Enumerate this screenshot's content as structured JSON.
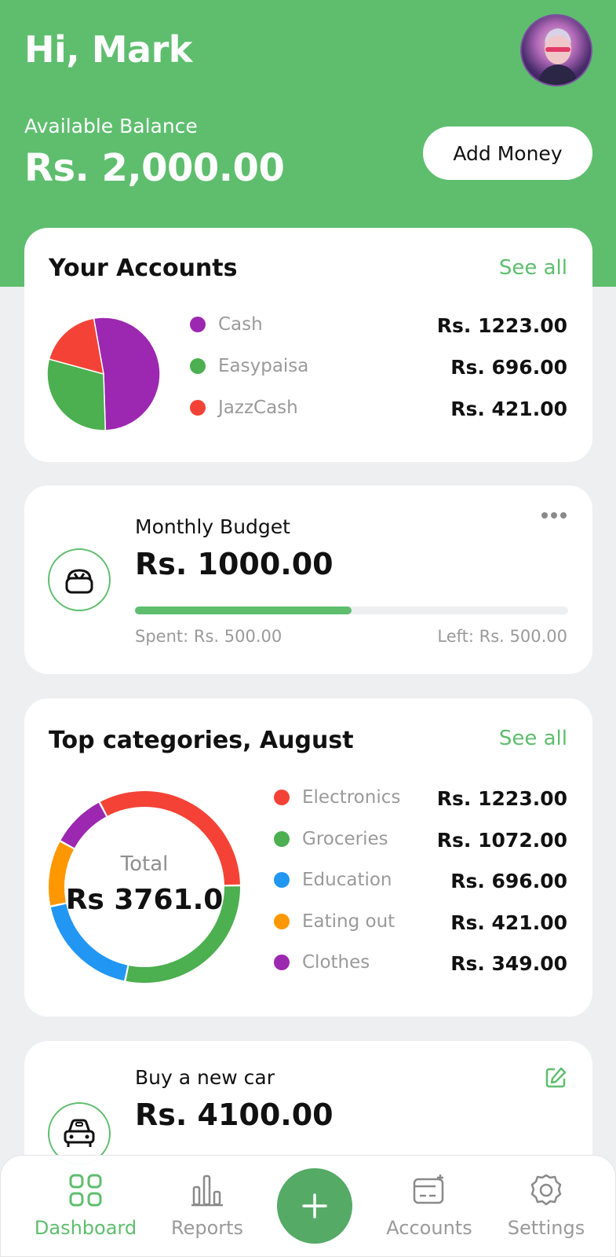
{
  "header": {
    "greeting": "Hi, Mark",
    "balance_label": "Available Balance",
    "balance_value": "Rs. 2,000.00",
    "add_money_label": "Add Money"
  },
  "accounts": {
    "title": "Your Accounts",
    "see_all": "See all",
    "items": [
      {
        "name": "Cash",
        "amount": "Rs. 1223.00",
        "value": 1223,
        "color": "#9c27b0"
      },
      {
        "name": "Easypaisa",
        "amount": "Rs. 696.00",
        "value": 696,
        "color": "#4caf50"
      },
      {
        "name": "JazzCash",
        "amount": "Rs. 421.00",
        "value": 421,
        "color": "#f44336"
      }
    ]
  },
  "budget": {
    "title": "Monthly Budget",
    "amount": "Rs. 1000.00",
    "spent": "Spent: Rs. 500.00",
    "left": "Left: Rs. 500.00",
    "progress": 0.5,
    "icon": "bag-icon"
  },
  "categories": {
    "title": "Top categories, August",
    "see_all": "See all",
    "total_label": "Total",
    "total_value": "Rs 3761.0",
    "items": [
      {
        "name": "Electronics",
        "amount": "Rs. 1223.00",
        "value": 1223,
        "color": "#f44336"
      },
      {
        "name": "Groceries",
        "amount": "Rs. 1072.00",
        "value": 1072,
        "color": "#4caf50"
      },
      {
        "name": "Education",
        "amount": "Rs. 696.00",
        "value": 696,
        "color": "#2196f3"
      },
      {
        "name": "Eating out",
        "amount": "Rs. 421.00",
        "value": 421,
        "color": "#ff9800"
      },
      {
        "name": "Clothes",
        "amount": "Rs. 349.00",
        "value": 349,
        "color": "#9c27b0"
      }
    ]
  },
  "goal": {
    "title": "Buy a new car",
    "amount": "Rs. 4100.00",
    "icon": "car-icon"
  },
  "nav": {
    "items": [
      {
        "label": "Dashboard",
        "icon": "grid-icon",
        "active": true
      },
      {
        "label": "Reports",
        "icon": "bar-chart-icon",
        "active": false
      },
      {
        "label": "Accounts",
        "icon": "wallet-icon",
        "active": false
      },
      {
        "label": "Settings",
        "icon": "gear-icon",
        "active": false
      }
    ],
    "fab_icon": "plus-icon"
  },
  "colors": {
    "brand": "#5ebe6e",
    "background": "#eeeff1"
  }
}
